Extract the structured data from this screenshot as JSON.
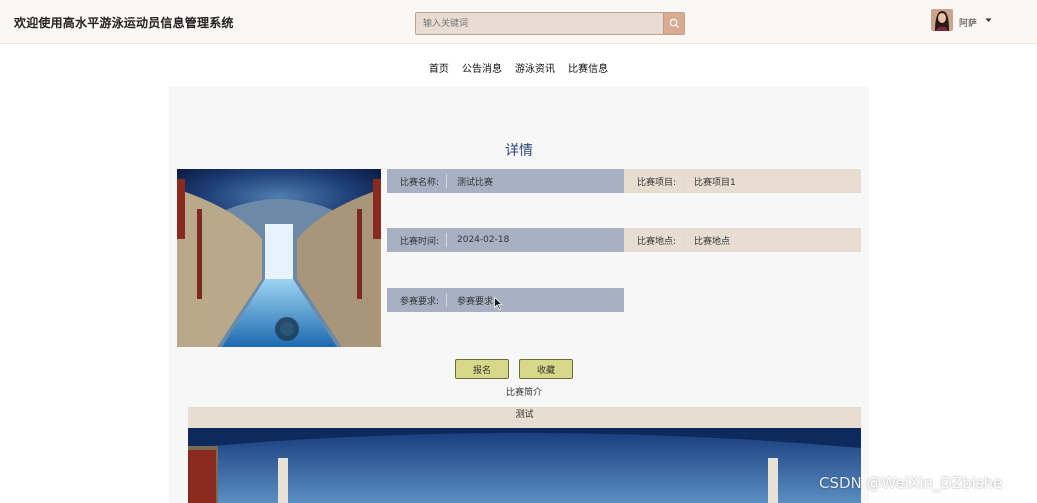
{
  "header": {
    "site_title": "欢迎使用高水平游泳运动员信息管理系统",
    "search_placeholder": "输入关键词",
    "user_name": "阿萨"
  },
  "nav": {
    "items": [
      "首页",
      "公告消息",
      "游泳资讯",
      "比赛信息"
    ]
  },
  "detail": {
    "title": "详情",
    "fields": {
      "name": {
        "label": "比赛名称:",
        "value": "测试比赛"
      },
      "project": {
        "label": "比赛项目:",
        "value": "比赛项目1"
      },
      "time": {
        "label": "比赛时间:",
        "value": "2024-02-18"
      },
      "location": {
        "label": "比赛地点:",
        "value": "比赛地点"
      },
      "requirement": {
        "label": "参赛要求:",
        "value": "参赛要求"
      }
    },
    "signup_label": "报名",
    "favorite_label": "收藏",
    "intro_label": "比赛简介",
    "intro_text": "测试"
  },
  "watermark": "CSDN @WeiXin_DZbishe",
  "colors": {
    "row_blue": "#a8b1c4",
    "row_beige": "#e8ddd1",
    "button": "#d8d88a",
    "title_blue": "#2b4a7a"
  }
}
